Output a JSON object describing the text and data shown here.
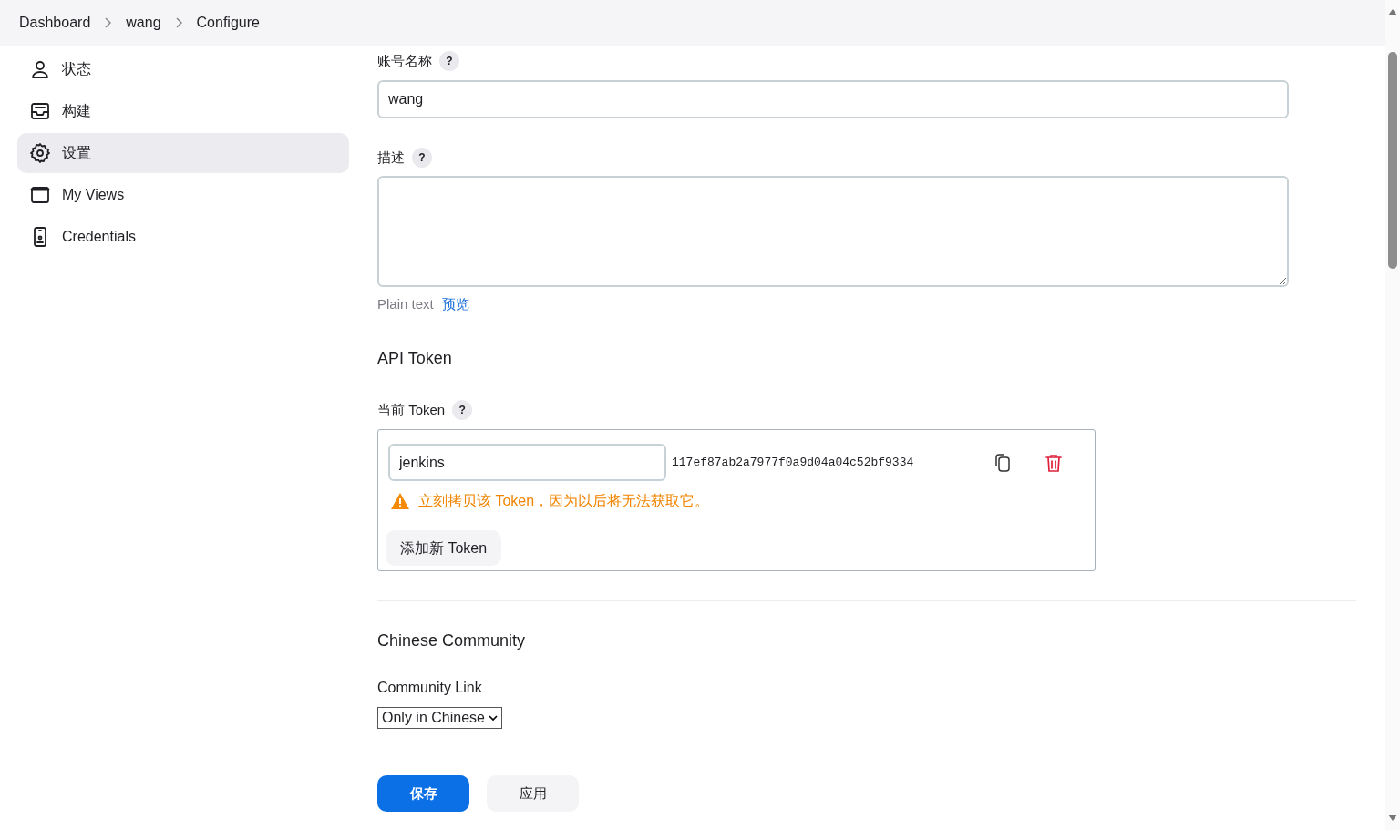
{
  "breadcrumbs": [
    {
      "label": "Dashboard"
    },
    {
      "label": "wang"
    },
    {
      "label": "Configure"
    }
  ],
  "sidebar": {
    "items": [
      {
        "label": "状态",
        "selected": false
      },
      {
        "label": "构建",
        "selected": false
      },
      {
        "label": "设置",
        "selected": true
      },
      {
        "label": "My Views",
        "selected": false
      },
      {
        "label": "Credentials",
        "selected": false
      }
    ]
  },
  "account_name": {
    "label": "账号名称",
    "help": "?",
    "value": "wang"
  },
  "description": {
    "label": "描述",
    "help": "?",
    "format": "Plain text",
    "preview_link": "预览"
  },
  "api_token": {
    "heading": "API Token",
    "label": "当前 Token",
    "help": "?",
    "token_name": "jenkins",
    "token_value": "117ef87ab2a7977f0a9d04a04c52bf9334",
    "warning": "立刻拷贝该 Token，因为以后将无法获取它。",
    "add_button": "添加新 Token"
  },
  "chinese_community": {
    "heading": "Chinese Community",
    "label": "Community Link",
    "select_value": "Only in Chinese"
  },
  "buttons": [
    {
      "label": "保存",
      "kind": "primary"
    },
    {
      "label": "应用",
      "kind": "secondary"
    }
  ]
}
